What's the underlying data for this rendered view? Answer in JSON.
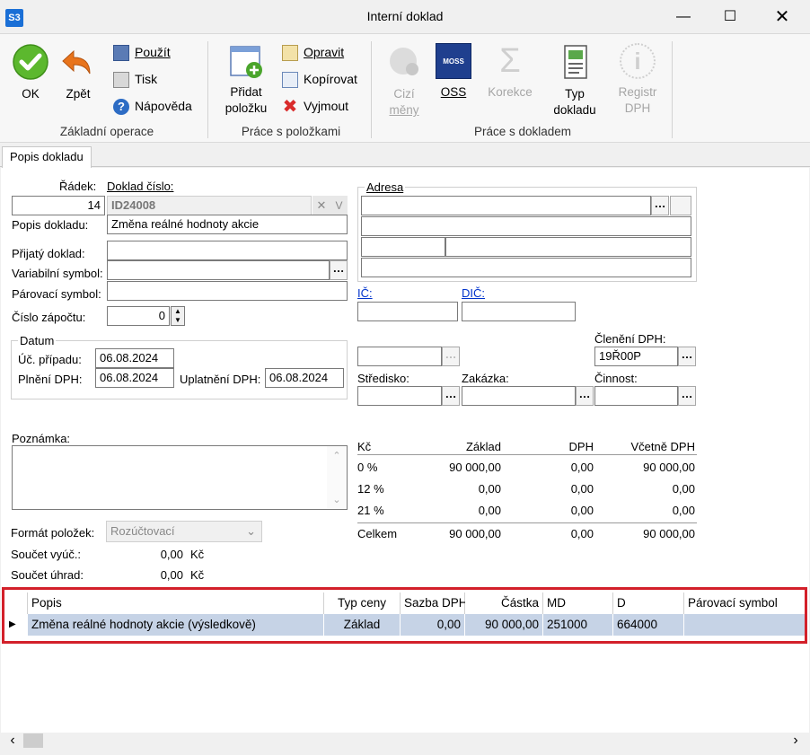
{
  "window": {
    "app_badge": "S3",
    "title": "Interní doklad"
  },
  "ribbon": {
    "ok": "OK",
    "zpet": "Zpět",
    "pouzit": "Použít",
    "tisk": "Tisk",
    "napoveda": "Nápověda",
    "group_zakladni": "Základní operace",
    "pridat_1": "Přidat",
    "pridat_2": "položku",
    "opravit": "Opravit",
    "kopirovat": "Kopírovat",
    "vyjmout": "Vyjmout",
    "group_polozky": "Práce s položkami",
    "cizi_1": "Cizí",
    "cizi_2": "měny",
    "oss": "OSS",
    "oss_badge": "MOSS",
    "korekce": "Korekce",
    "typ_1": "Typ",
    "typ_2": "dokladu",
    "registr_1": "Registr",
    "registr_2": "DPH",
    "group_doklad": "Práce s dokladem"
  },
  "tab": {
    "popis": "Popis dokladu"
  },
  "form": {
    "radek_label": "Řádek:",
    "radek_value": "14",
    "doklad_label": "Doklad číslo:",
    "doklad_value": "ID24008",
    "popis_label": "Popis dokladu:",
    "popis_value": "Změna reálné hodnoty akcie",
    "prijaty_label": "Přijatý doklad:",
    "prijaty_value": "",
    "variabilni_label": "Variabilní symbol:",
    "variabilni_value": "",
    "parovaci_label": "Párovací symbol:",
    "parovaci_value": "",
    "zapoctu_label": "Číslo zápočtu:",
    "zapoctu_value": "0",
    "datum_group": "Datum",
    "uc_label": "Úč. případu:",
    "uc_value": "06.08.2024",
    "plneni_label": "Plnění DPH:",
    "plneni_value": "06.08.2024",
    "uplatneni_label": "Uplatnění DPH:",
    "uplatneni_value": "06.08.2024",
    "poznamka_label": "Poznámka:",
    "format_label": "Formát položek:",
    "format_value": "Rozúčtovací",
    "soucet_vyuc_label": "Součet vyúč.:",
    "soucet_vyuc_value": "0,00",
    "soucet_vyuc_cur": "Kč",
    "soucet_uhrad_label": "Součet úhrad:",
    "soucet_uhrad_value": "0,00",
    "soucet_uhrad_cur": "Kč",
    "adresa_group": "Adresa",
    "ic_label": "IČ:",
    "dic_label": "DIČ:",
    "cleneni_label": "Členění DPH:",
    "cleneni_value": "19Ř00P",
    "stredisko_label": "Středisko:",
    "zakazka_label": "Zakázka:",
    "cinnost_label": "Činnost:"
  },
  "vat_table": {
    "headers": [
      "Kč",
      "Základ",
      "DPH",
      "Včetně DPH"
    ],
    "rows": [
      [
        "0 %",
        "90 000,00",
        "0,00",
        "90 000,00"
      ],
      [
        "12 %",
        "0,00",
        "0,00",
        "0,00"
      ],
      [
        "21 %",
        "0,00",
        "0,00",
        "0,00"
      ]
    ],
    "total": [
      "Celkem",
      "90 000,00",
      "0,00",
      "90 000,00"
    ]
  },
  "grid": {
    "headers": [
      "Popis",
      "Typ ceny",
      "Sazba DPH",
      "Částka",
      "MD",
      "D",
      "Párovací symbol"
    ],
    "rows": [
      [
        "Změna reálné hodnoty akcie (výsledkově)",
        "Základ",
        "0,00",
        "90 000,00",
        "251000",
        "664000",
        ""
      ]
    ]
  },
  "colors": {
    "accent": "#1a6fd6",
    "highlight": "#d3202a",
    "row_selected": "#c6d3e6"
  }
}
